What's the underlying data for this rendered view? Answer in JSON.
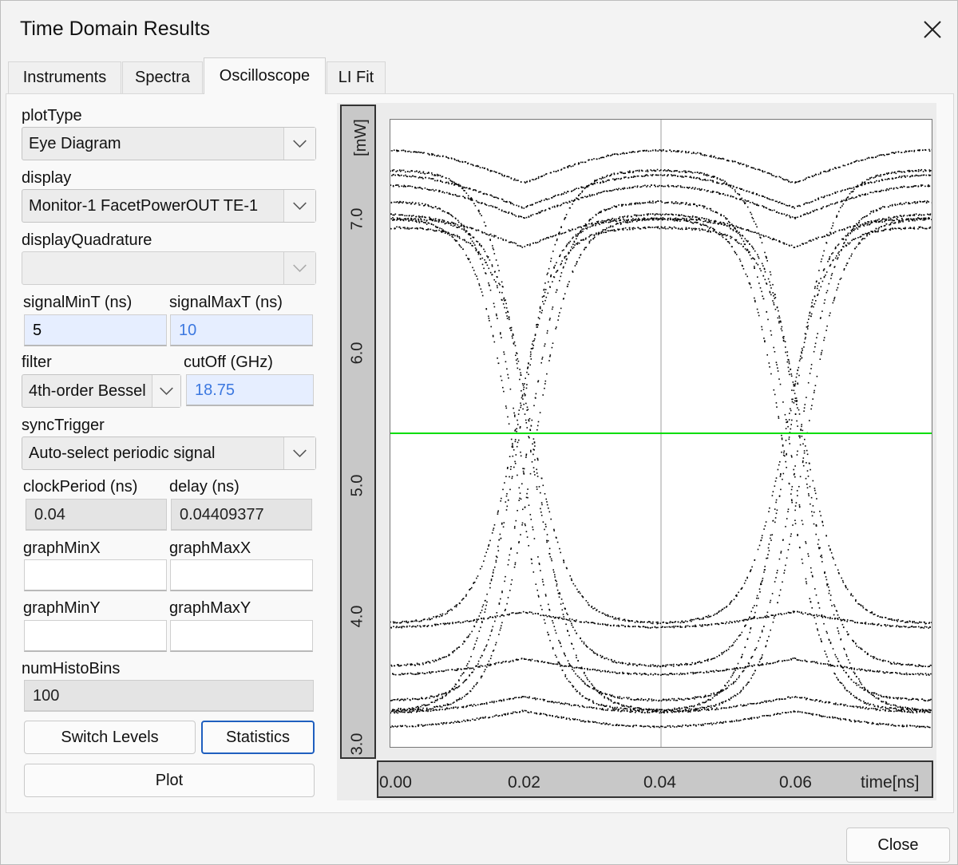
{
  "window": {
    "title": "Time Domain Results",
    "close_label": "Close"
  },
  "tabs": [
    {
      "label": "Instruments",
      "active": false
    },
    {
      "label": "Spectra",
      "active": false
    },
    {
      "label": "Oscilloscope",
      "active": true
    },
    {
      "label": "LI Fit",
      "active": false
    }
  ],
  "form": {
    "plotType": {
      "label": "plotType",
      "value": "Eye Diagram"
    },
    "display": {
      "label": "display",
      "value": "Monitor-1 FacetPowerOUT TE-1"
    },
    "displayQuadrature": {
      "label": "displayQuadrature",
      "value": ""
    },
    "signalMinT": {
      "label": "signalMinT (ns)",
      "value": "5"
    },
    "signalMaxT": {
      "label": "signalMaxT (ns)",
      "value": "10"
    },
    "filter": {
      "label": "filter",
      "value": "4th-order Bessel"
    },
    "cutOff": {
      "label": "cutOff (GHz)",
      "value": "18.75"
    },
    "syncTrigger": {
      "label": "syncTrigger",
      "value": "Auto-select periodic signal"
    },
    "clockPeriod": {
      "label": "clockPeriod (ns)",
      "value": "0.04"
    },
    "delay": {
      "label": "delay (ns)",
      "value": "0.04409377"
    },
    "graphMinX": {
      "label": "graphMinX",
      "value": ""
    },
    "graphMaxX": {
      "label": "graphMaxX",
      "value": ""
    },
    "graphMinY": {
      "label": "graphMinY",
      "value": ""
    },
    "graphMaxY": {
      "label": "graphMaxY",
      "value": ""
    },
    "numHistoBins": {
      "label": "numHistoBins",
      "value": "100"
    }
  },
  "buttons": {
    "switch_levels": "Switch Levels",
    "statistics": "Statistics",
    "plot": "Plot"
  },
  "chart_data": {
    "type": "scatter",
    "title": "",
    "xlabel": "time[ns]",
    "ylabel": "[mW]",
    "xlim": [
      0.0,
      0.08
    ],
    "ylim": [
      3.0,
      7.8
    ],
    "x_ticks": [
      "0.00",
      "0.02",
      "0.04",
      "0.06"
    ],
    "y_ticks": [
      "3.0",
      "4.0",
      "5.0",
      "6.0",
      "7.0"
    ],
    "vertical_marker_x": 0.04,
    "threshold_y": 5.4,
    "threshold_color": "#00dd00",
    "point_color": "#000000",
    "grid": false
  }
}
